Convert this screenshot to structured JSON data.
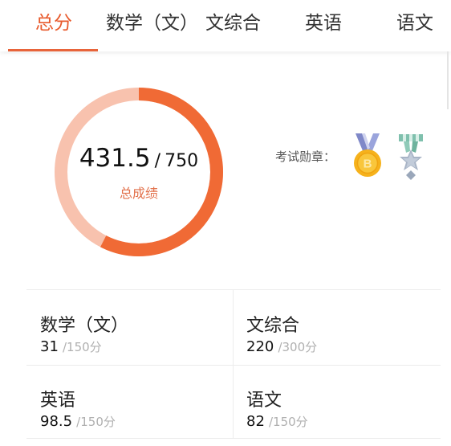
{
  "tabs": [
    {
      "label": "总分",
      "active": true
    },
    {
      "label": "数学（文）",
      "active": false
    },
    {
      "label": "文综合",
      "active": false
    },
    {
      "label": "英语",
      "active": false
    },
    {
      "label": "语文",
      "active": false
    }
  ],
  "summary": {
    "score": "431.5",
    "separator": "/",
    "total": "750",
    "caption": "总成绩",
    "progress": 0.5753
  },
  "medals": {
    "label": "考试勋章：",
    "items": [
      {
        "icon": "gold-b-medal-icon",
        "letter": "B"
      },
      {
        "icon": "silver-star-medal-icon"
      }
    ]
  },
  "subjects": [
    {
      "name": "数学（文）",
      "score": "31",
      "full": "/150分"
    },
    {
      "name": "文综合",
      "score": "220",
      "full": "/300分"
    },
    {
      "name": "英语",
      "score": "98.5",
      "full": "/150分"
    },
    {
      "name": "语文",
      "score": "82",
      "full": "/150分"
    }
  ],
  "colors": {
    "accent": "#e85a2c",
    "ring_track": "#f8c2ae",
    "ring_fill": "#f06a35"
  }
}
